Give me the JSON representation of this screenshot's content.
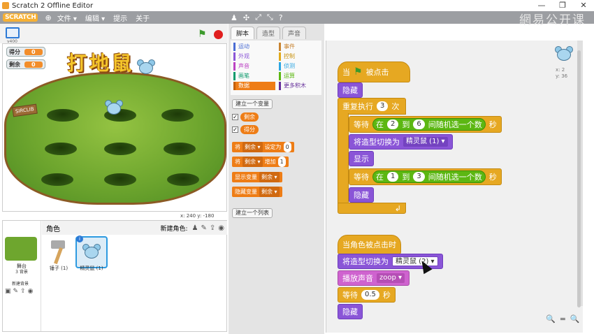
{
  "window": {
    "title": "Scratch 2 Offline Editor",
    "min": "—",
    "max": "❐",
    "close": "✕"
  },
  "menubar": {
    "logo": "SCRATCH",
    "items": [
      "文件 ▾",
      "编辑 ▾",
      "提示",
      "关于"
    ]
  },
  "watermark": "網易公开课",
  "stage": {
    "version": "v400",
    "monitors": [
      {
        "label": "得分",
        "value": "0"
      },
      {
        "label": "剩余",
        "value": "0"
      }
    ],
    "title_art": "打地鼠",
    "sign": "SIRCLIB",
    "coords": "x: 240  y: -180"
  },
  "sprites": {
    "header": "角色",
    "new_sprite_label": "新建角色:",
    "stage_label": "舞台",
    "stage_sub": "3 背景",
    "new_backdrop": "新建背景",
    "items": [
      {
        "label": "锤子 (1)"
      },
      {
        "label": "精灵鼠 (1)"
      }
    ]
  },
  "palette": {
    "tabs": [
      "脚本",
      "造型",
      "声音"
    ],
    "categories_left": [
      {
        "label": "运动",
        "color": "#4a6cd4"
      },
      {
        "label": "外观",
        "color": "#8a55d7"
      },
      {
        "label": "声音",
        "color": "#bb42c3"
      },
      {
        "label": "画笔",
        "color": "#0e9a6c"
      },
      {
        "label": "数据",
        "color": "#ee7d16"
      }
    ],
    "categories_right": [
      {
        "label": "事件",
        "color": "#c88330"
      },
      {
        "label": "控制",
        "color": "#e1a91a"
      },
      {
        "label": "侦测",
        "color": "#2ca5e2"
      },
      {
        "label": "运算",
        "color": "#5cb712"
      },
      {
        "label": "更多积木",
        "color": "#632d99"
      }
    ],
    "make_var": "建立一个变量",
    "vars": [
      "剩余",
      "得分"
    ],
    "blocks": [
      {
        "pre": "将",
        "drop": "剩余 ▾",
        "mid": "设定为",
        "num": "0"
      },
      {
        "pre": "将",
        "drop": "剩余 ▾",
        "mid": "增加",
        "num": "1"
      },
      {
        "pre": "显示变量",
        "drop": "剩余 ▾",
        "mid": "",
        "num": ""
      },
      {
        "pre": "隐藏变量",
        "drop": "剩余 ▾",
        "mid": "",
        "num": ""
      }
    ],
    "make_list": "建立一个列表"
  },
  "scripts": {
    "sprite_x": "x: 2",
    "sprite_y": "y: 36",
    "script1": {
      "hat": [
        "当",
        "被点击"
      ],
      "hide1": "隐藏",
      "repeat": {
        "pre": "重复执行",
        "count": "3",
        "post": "次"
      },
      "wait1": {
        "pre": "等待",
        "in": "在",
        "a": "2",
        "to": "到",
        "b": "6",
        "rand": "间随机选一个数",
        "unit": "秒"
      },
      "switch1": {
        "label": "将造型切换为",
        "value": "精灵鼠 (1) ▾"
      },
      "show": "显示",
      "wait2": {
        "pre": "等待",
        "in": "在",
        "a": "1",
        "to": "到",
        "b": "3",
        "rand": "间随机选一个数",
        "unit": "秒"
      },
      "hide2": "隐藏",
      "loop_arrow": "↲"
    },
    "script2": {
      "hat": "当角色被点击时",
      "switch": {
        "label": "将造型切换为",
        "value": "精灵鼠 (2) ▾"
      },
      "sound": {
        "label": "播放声音",
        "value": "zoop ▾"
      },
      "wait": {
        "pre": "等待",
        "value": "0.5",
        "unit": "秒"
      },
      "hide": "隐藏"
    },
    "zoom": [
      "🔍",
      "=",
      "🔍"
    ]
  }
}
